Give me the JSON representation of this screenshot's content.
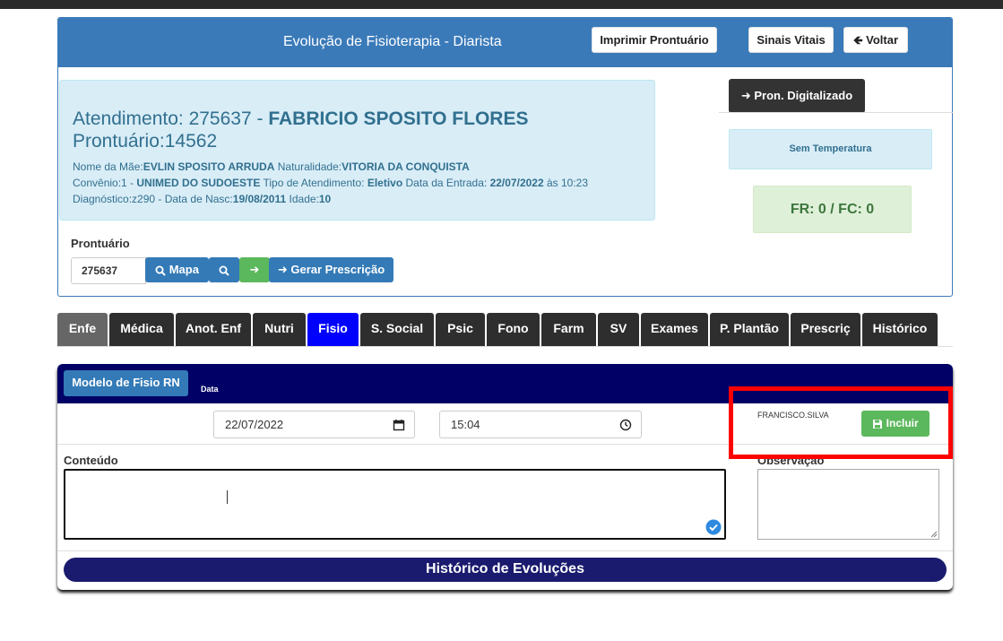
{
  "header": {
    "title": "Evolução de Fisioterapia - Diarista",
    "print_label": "Imprimir Prontuário",
    "vitals_label": "Sinais Vitais",
    "back_label": "Voltar"
  },
  "patient": {
    "atendimento_prefix": "Atendimento: 275637 - ",
    "name": "FABRICIO SPOSITO FLORES",
    "prontuario": "Prontuário:14562",
    "mae_label": "Nome da Mãe:",
    "mae_value": "EVLIN SPOSITO ARRUDA",
    "natural_label": " Naturalidade:",
    "natural_value": "VITORIA DA CONQUISTA",
    "convenio_label": "Convênio:1 - ",
    "convenio_value": "UNIMED DO SUDOESTE",
    "tipo_label": " Tipo de Atendimento: ",
    "tipo_value": "Eletivo",
    "entrada_label": " Data da Entrada: ",
    "entrada_value": "22/07/2022",
    "entrada_hora": " às 10:23",
    "diag_label": "Diagnóstico:z290 - Data de Nasc:",
    "nasc_value": "19/08/2011",
    "idade_label": " Idade:",
    "idade_value": "10"
  },
  "side": {
    "pron_digitalizado": "Pron. Digitalizado",
    "temperatura": "Sem Temperatura",
    "vitais": "FR: 0 / FC: 0"
  },
  "prontuario_search": {
    "label": "Prontuário",
    "value": "275637",
    "mapa_label": "Mapa",
    "gerar_label": "Gerar Prescrição"
  },
  "tabs": [
    {
      "label": "Enfe"
    },
    {
      "label": "Médica"
    },
    {
      "label": "Anot. Enf"
    },
    {
      "label": "Nutri"
    },
    {
      "label": "Fisio"
    },
    {
      "label": "S. Social"
    },
    {
      "label": "Psic"
    },
    {
      "label": "Fono"
    },
    {
      "label": "Farm"
    },
    {
      "label": "SV"
    },
    {
      "label": "Exames"
    },
    {
      "label": "P. Plantão"
    },
    {
      "label": "Prescriç"
    },
    {
      "label": "Histórico"
    }
  ],
  "form": {
    "modelo_label": "Modelo de Fisio RN",
    "data_label": "Data",
    "date_value": "22/07/2022",
    "time_value": "15:04",
    "user": "FRANCISCO.SILVA",
    "incluir_label": "Incluir",
    "conteudo_label": "Conteúdo",
    "observacao_label": "Observação",
    "historico_label": "Histórico de Evoluções"
  }
}
